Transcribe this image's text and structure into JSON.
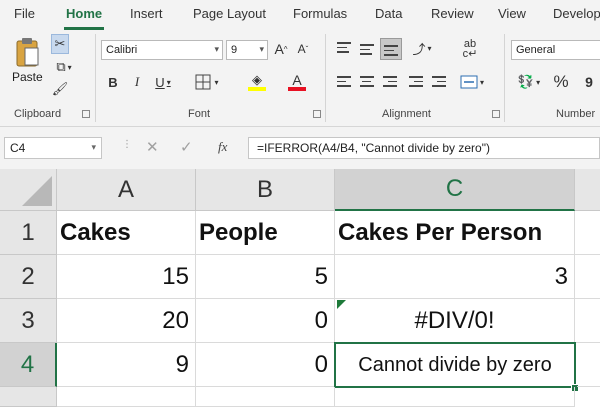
{
  "menu": {
    "tabs": [
      {
        "label": "File",
        "active": false
      },
      {
        "label": "Home",
        "active": true
      },
      {
        "label": "Insert",
        "active": false
      },
      {
        "label": "Page Layout",
        "active": false
      },
      {
        "label": "Formulas",
        "active": false
      },
      {
        "label": "Data",
        "active": false
      },
      {
        "label": "Review",
        "active": false
      },
      {
        "label": "View",
        "active": false
      },
      {
        "label": "Develop",
        "active": false
      }
    ]
  },
  "ribbon": {
    "clipboard": {
      "paste_label": "Paste",
      "group_label": "Clipboard"
    },
    "font": {
      "font_name": "Calibri",
      "font_size": "9",
      "group_label": "Font",
      "highlight_color": "#ffff00",
      "font_color": "#e81123"
    },
    "alignment": {
      "group_label": "Alignment"
    },
    "number": {
      "format": "General",
      "group_label": "Number",
      "percent_symbol": "%"
    }
  },
  "formula_bar": {
    "name_box": "C4",
    "fx_symbol": "fx",
    "formula": "=IFERROR(A4/B4, \"Cannot divide by zero\")"
  },
  "sheet": {
    "columns": [
      "A",
      "B",
      "C"
    ],
    "rows": [
      "1",
      "2",
      "3",
      "4"
    ],
    "cells": {
      "A1": "Cakes",
      "B1": "People",
      "C1": "Cakes Per Person",
      "A2": "15",
      "B2": "5",
      "C2": "3",
      "A3": "20",
      "B3": "0",
      "C3": "#DIV/0!",
      "A4": "9",
      "B4": "0",
      "C4": "Cannot divide by zero"
    },
    "selected_cell": "C4",
    "accent_color": "#217346"
  }
}
